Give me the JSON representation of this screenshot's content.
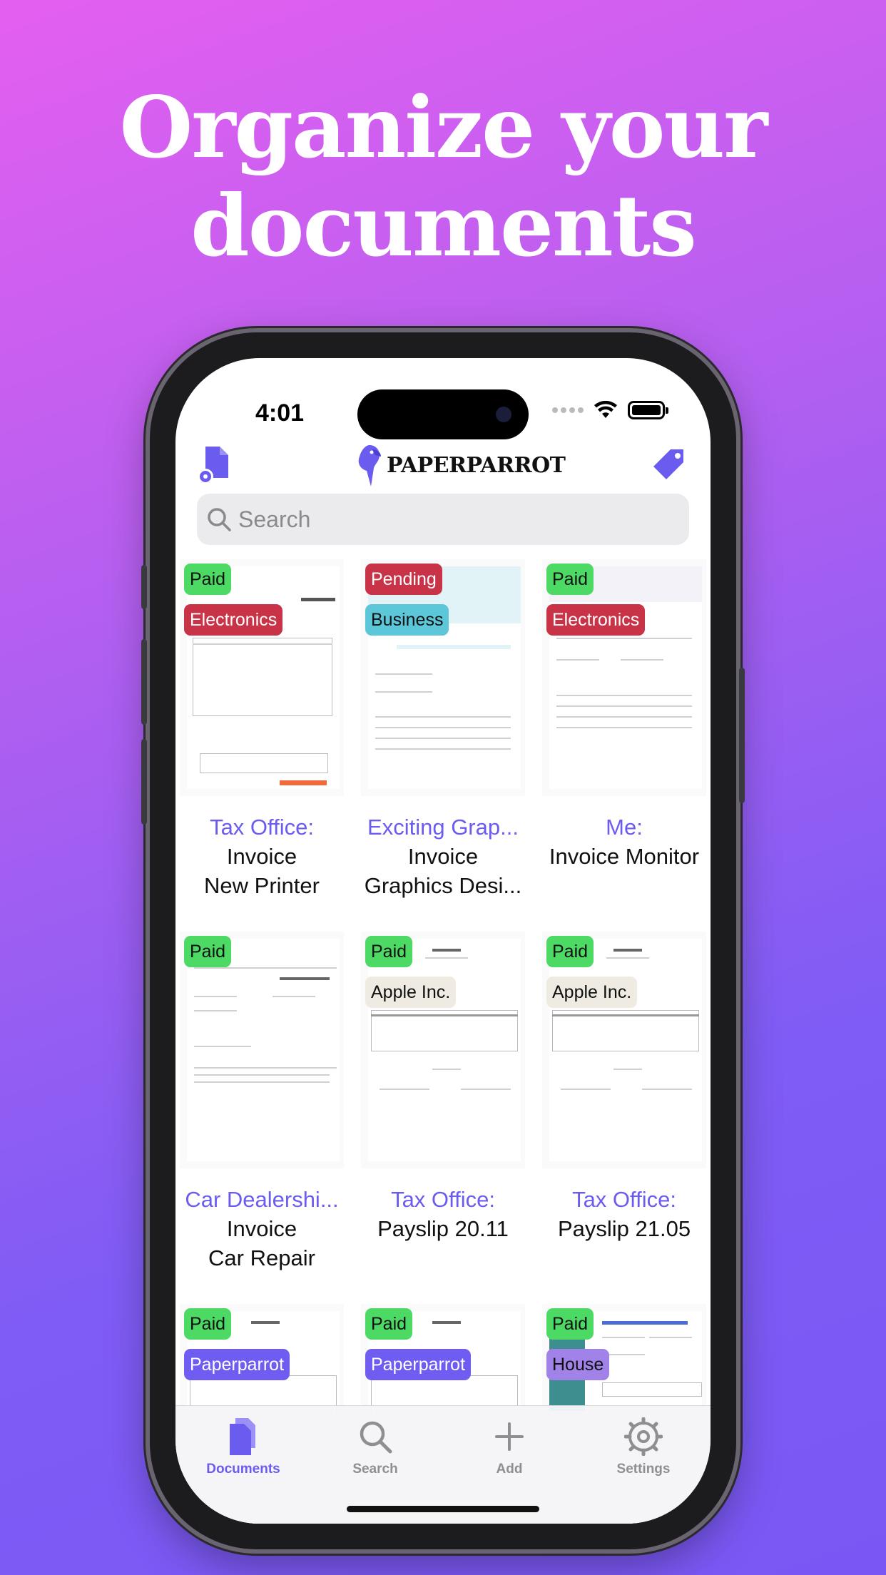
{
  "headline": {
    "line1": "Organize your",
    "line2": "documents"
  },
  "status_bar": {
    "time": "4:01"
  },
  "navbar": {
    "logo_text": "PAPERPARROT"
  },
  "search": {
    "placeholder": "Search"
  },
  "colors": {
    "accent": "#6b5cf0",
    "paid": "#4cd964",
    "pending": "#c93348",
    "electronics": "#c93348",
    "business": "#5bc7d8",
    "apple": "#efebe3",
    "paperparrot": "#6f5cf0",
    "house": "#a182e8"
  },
  "documents": [
    {
      "status": "Paid",
      "category": "Electronics",
      "sender": "Tax Office:",
      "title": "Invoice",
      "subtitle": "New Printer"
    },
    {
      "status": "Pending",
      "category": "Business",
      "sender": "Exciting Grap...",
      "title": "Invoice",
      "subtitle": "Graphics Desi..."
    },
    {
      "status": "Paid",
      "category": "Electronics",
      "sender": "Me:",
      "title": "Invoice Monitor",
      "subtitle": ""
    },
    {
      "status": "Paid",
      "category": "",
      "sender": "Car Dealershi...",
      "title": "Invoice",
      "subtitle": "Car Repair"
    },
    {
      "status": "Paid",
      "category": "Apple Inc.",
      "sender": "Tax Office:",
      "title": "Payslip 20.11",
      "subtitle": ""
    },
    {
      "status": "Paid",
      "category": "Apple Inc.",
      "sender": "Tax Office:",
      "title": "Payslip 21.05",
      "subtitle": ""
    },
    {
      "status": "Paid",
      "category": "Paperparrot",
      "sender": "",
      "title": "",
      "subtitle": ""
    },
    {
      "status": "Paid",
      "category": "Paperparrot",
      "sender": "",
      "title": "",
      "subtitle": ""
    },
    {
      "status": "Paid",
      "category": "House",
      "sender": "",
      "title": "",
      "subtitle": ""
    }
  ],
  "tabbar": {
    "tabs": [
      {
        "label": "Documents",
        "icon": "documents-icon",
        "active": true
      },
      {
        "label": "Search",
        "icon": "search-icon",
        "active": false
      },
      {
        "label": "Add",
        "icon": "plus-icon",
        "active": false
      },
      {
        "label": "Settings",
        "icon": "gear-icon",
        "active": false
      }
    ]
  }
}
